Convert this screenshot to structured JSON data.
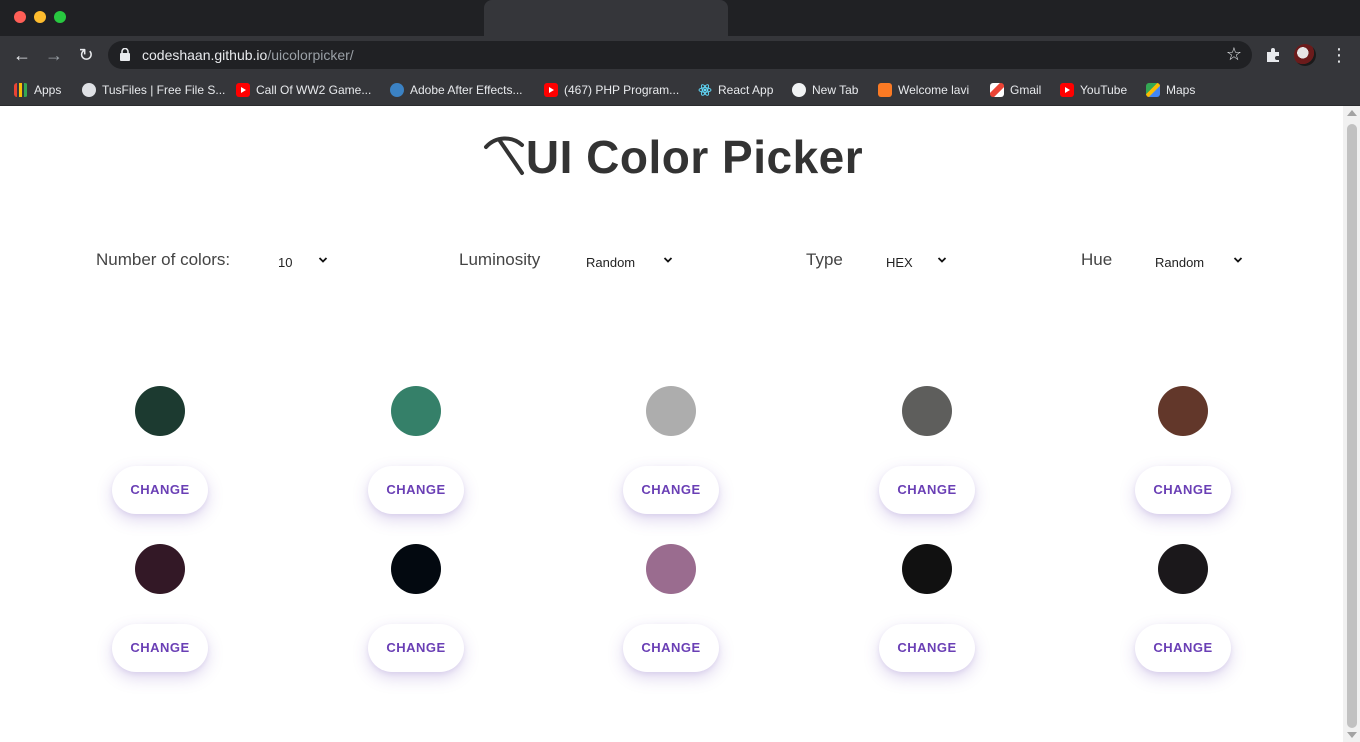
{
  "browser": {
    "url_host": "codeshaan.github.io",
    "url_path": "/uicolorpicker/",
    "bookmarks": [
      {
        "label": "Apps",
        "icon": "apps-grid-icon"
      },
      {
        "label": "TusFiles | Free File S...",
        "icon": "globe-icon"
      },
      {
        "label": "Call Of WW2 Game...",
        "icon": "youtube-icon"
      },
      {
        "label": "Adobe After Effects...",
        "icon": "adobe-icon"
      },
      {
        "label": "(467) PHP Program...",
        "icon": "youtube-icon"
      },
      {
        "label": "React App",
        "icon": "react-icon"
      },
      {
        "label": "New Tab",
        "icon": "blank-circle-icon"
      },
      {
        "label": "Welcome lavi",
        "icon": "xampp-icon"
      },
      {
        "label": "Gmail",
        "icon": "gmail-icon"
      },
      {
        "label": "YouTube",
        "icon": "youtube-icon"
      },
      {
        "label": "Maps",
        "icon": "maps-icon"
      }
    ]
  },
  "page": {
    "title": "UI Color Picker",
    "title_icon": "pickaxe-icon",
    "controls": [
      {
        "label": "Number of colors:",
        "value": "10"
      },
      {
        "label": "Luminosity",
        "value": "Random"
      },
      {
        "label": "Type",
        "value": "HEX"
      },
      {
        "label": "Hue",
        "value": "Random"
      }
    ],
    "button_label": "CHANGE",
    "accent_color": "#6a3fb5",
    "swatches": [
      "#1c3a30",
      "#358069",
      "#adadad",
      "#5e5e5c",
      "#62372a",
      "#331826",
      "#030910",
      "#9a6c8f",
      "#111111",
      "#1b181b"
    ]
  }
}
